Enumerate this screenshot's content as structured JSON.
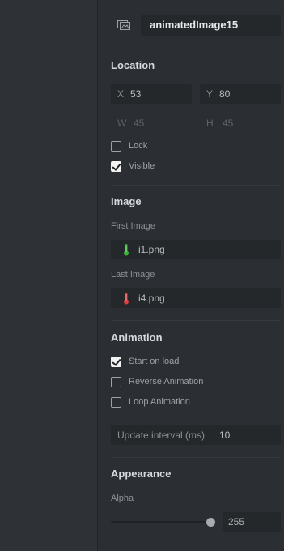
{
  "object": {
    "name": "animatedImage15",
    "icon": "image-object-icon"
  },
  "location": {
    "title": "Location",
    "x_label": "X",
    "x_value": "53",
    "y_label": "Y",
    "y_value": "80",
    "w_label": "W",
    "w_value": "45",
    "h_label": "H",
    "h_value": "45",
    "lock_label": "Lock",
    "lock_checked": false,
    "visible_label": "Visible",
    "visible_checked": true
  },
  "image": {
    "title": "Image",
    "first_label": "First Image",
    "first_file": "i1.png",
    "first_icon": "green-thermometer-icon",
    "last_label": "Last Image",
    "last_file": "i4.png",
    "last_icon": "red-thermometer-icon"
  },
  "animation": {
    "title": "Animation",
    "start_label": "Start on load",
    "start_checked": true,
    "reverse_label": "Reverse Animation",
    "reverse_checked": false,
    "loop_label": "Loop Animation",
    "loop_checked": false,
    "interval_label": "Update interval (ms)",
    "interval_value": "10"
  },
  "appearance": {
    "title": "Appearance",
    "alpha_label": "Alpha",
    "alpha_value": "255",
    "alpha_max": 255
  },
  "colors": {
    "panel_bg": "#2b2e32",
    "field_bg": "#25282b",
    "thermo_green": "#3ab83a",
    "thermo_red": "#e23b3b"
  }
}
